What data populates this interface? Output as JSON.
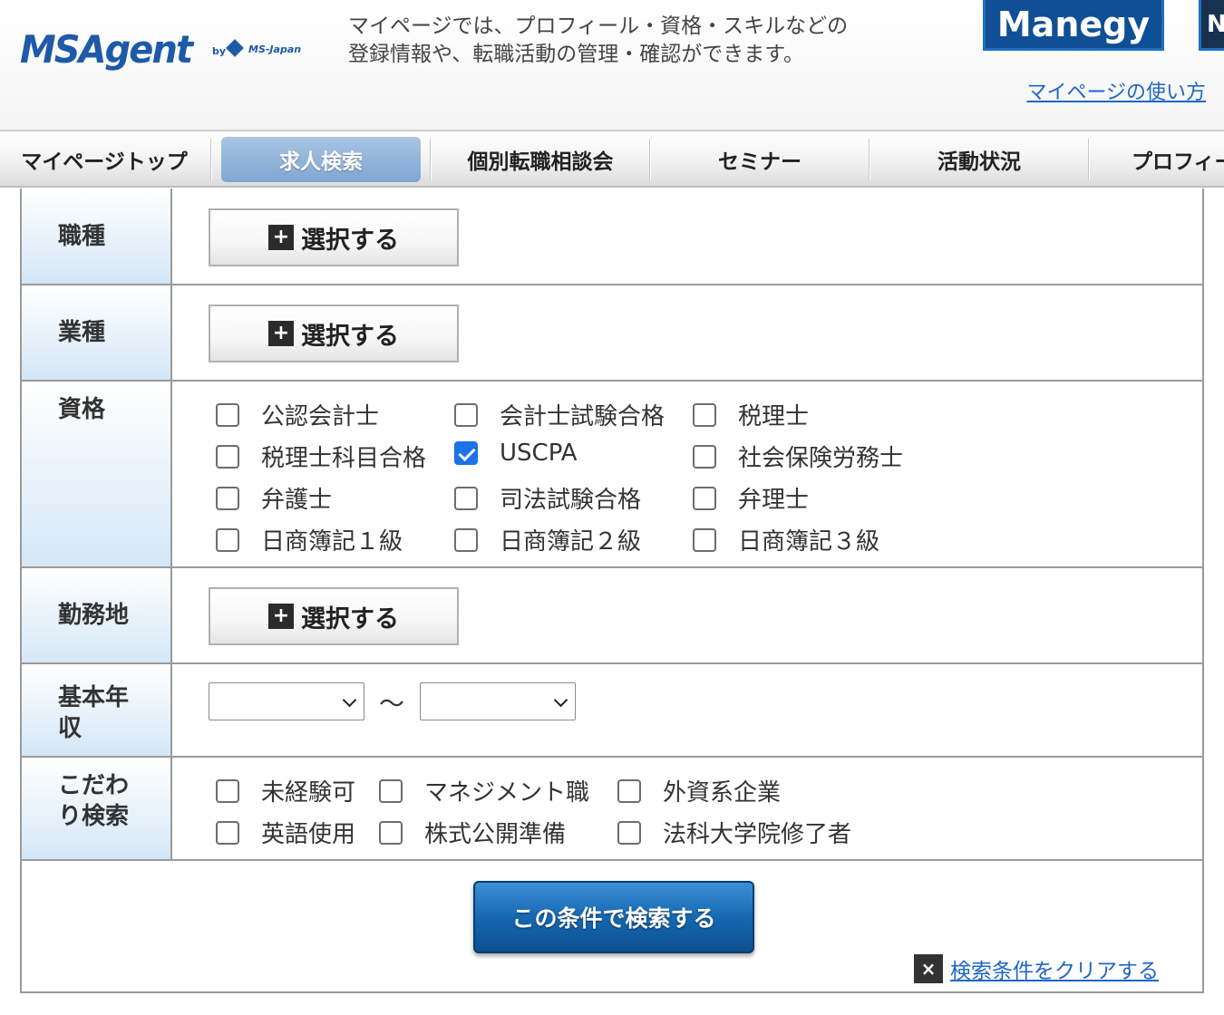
{
  "header": {
    "logo_text": "MSAgent",
    "logo_by": "by",
    "logo_company": "MS-Japan",
    "description": "マイページでは、プロフィール・資格・スキルなどの登録情報や、転職活動の管理・確認ができます。",
    "manegy_label": "Manegy",
    "second_banner_label": "N",
    "help_link": "マイページの使い方"
  },
  "nav": {
    "items": [
      {
        "label": "マイページトップ",
        "active": false
      },
      {
        "label": "求人検索",
        "active": true
      },
      {
        "label": "個別転職相談会",
        "active": false
      },
      {
        "label": "セミナー",
        "active": false
      },
      {
        "label": "活動状況",
        "active": false
      },
      {
        "label": "プロフィー",
        "active": false
      }
    ]
  },
  "form": {
    "job_type": {
      "label": "職種",
      "button": "選択する"
    },
    "industry": {
      "label": "業種",
      "button": "選択する"
    },
    "qualification": {
      "label": "資格",
      "options": [
        {
          "label": "公認会計士",
          "checked": false
        },
        {
          "label": "会計士試験合格",
          "checked": false
        },
        {
          "label": "税理士",
          "checked": false
        },
        {
          "label": "税理士科目合格",
          "checked": false
        },
        {
          "label": "USCPA",
          "checked": true
        },
        {
          "label": "社会保険労務士",
          "checked": false
        },
        {
          "label": "弁護士",
          "checked": false
        },
        {
          "label": "司法試験合格",
          "checked": false
        },
        {
          "label": "弁理士",
          "checked": false
        },
        {
          "label": "日商簿記１級",
          "checked": false
        },
        {
          "label": "日商簿記２級",
          "checked": false
        },
        {
          "label": "日商簿記３級",
          "checked": false
        }
      ]
    },
    "location": {
      "label": "勤務地",
      "button": "選択する"
    },
    "salary": {
      "label_line1": "基本年",
      "label_line2": "収",
      "min_value": "",
      "max_value": "",
      "separator": "〜"
    },
    "preferences": {
      "label_line1": "こだわ",
      "label_line2": "り検索",
      "options": [
        {
          "label": "未経験可",
          "checked": false
        },
        {
          "label": "マネジメント職",
          "checked": false
        },
        {
          "label": "外資系企業",
          "checked": false
        },
        {
          "label": "英語使用",
          "checked": false
        },
        {
          "label": "株式公開準備",
          "checked": false
        },
        {
          "label": "法科大学院修了者",
          "checked": false
        }
      ]
    },
    "search_button": "この条件で検索する",
    "clear_icon": "×",
    "clear_link": "検索条件をクリアする"
  },
  "colors": {
    "brand_blue": "#1d5aa8",
    "nav_active": "#7ea6d3",
    "search_button": "#1668b3",
    "label_bg": "#d3e7f7",
    "link": "#1e66c4",
    "checkbox_checked": "#1a73e8"
  },
  "icons": {
    "plus": "plus-icon",
    "close": "close-icon",
    "chevron": "chevron-down-icon",
    "check": "check-icon"
  }
}
